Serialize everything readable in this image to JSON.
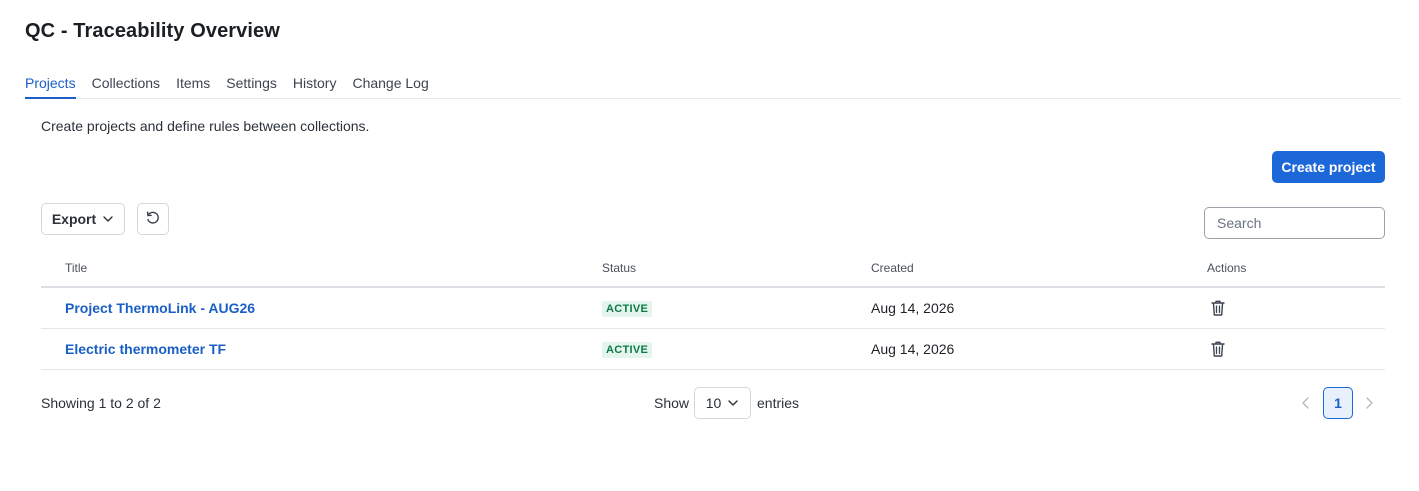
{
  "header": {
    "title": "QC - Traceability Overview"
  },
  "tabs": [
    {
      "label": "Projects",
      "active": true
    },
    {
      "label": "Collections",
      "active": false
    },
    {
      "label": "Items",
      "active": false
    },
    {
      "label": "Settings",
      "active": false
    },
    {
      "label": "History",
      "active": false
    },
    {
      "label": "Change Log",
      "active": false
    }
  ],
  "description": "Create projects and define rules between collections.",
  "toolbar": {
    "create_label": "Create project",
    "export_label": "Export",
    "search_placeholder": "Search",
    "search_value": ""
  },
  "table": {
    "columns": [
      "Title",
      "Status",
      "Created",
      "Actions"
    ],
    "rows": [
      {
        "title": "Project ThermoLink - AUG26",
        "status": "ACTIVE",
        "created": "Aug 14, 2026"
      },
      {
        "title": "Electric thermometer TF",
        "status": "ACTIVE",
        "created": "Aug 14, 2026"
      }
    ]
  },
  "footer": {
    "showing": "Showing 1 to 2 of 2",
    "show_label": "Show",
    "page_size": "10",
    "entries_label": "entries",
    "current_page": "1"
  },
  "colors": {
    "accent": "#1d68d9",
    "link": "#1a5fc8",
    "status_active_bg": "#e3f5ec",
    "status_active_text": "#0d7a45"
  },
  "icons": {
    "export_chevron": "chevron-down-icon",
    "refresh": "refresh-icon",
    "delete": "trash-icon",
    "prev": "chevron-left-icon",
    "next": "chevron-right-icon"
  }
}
